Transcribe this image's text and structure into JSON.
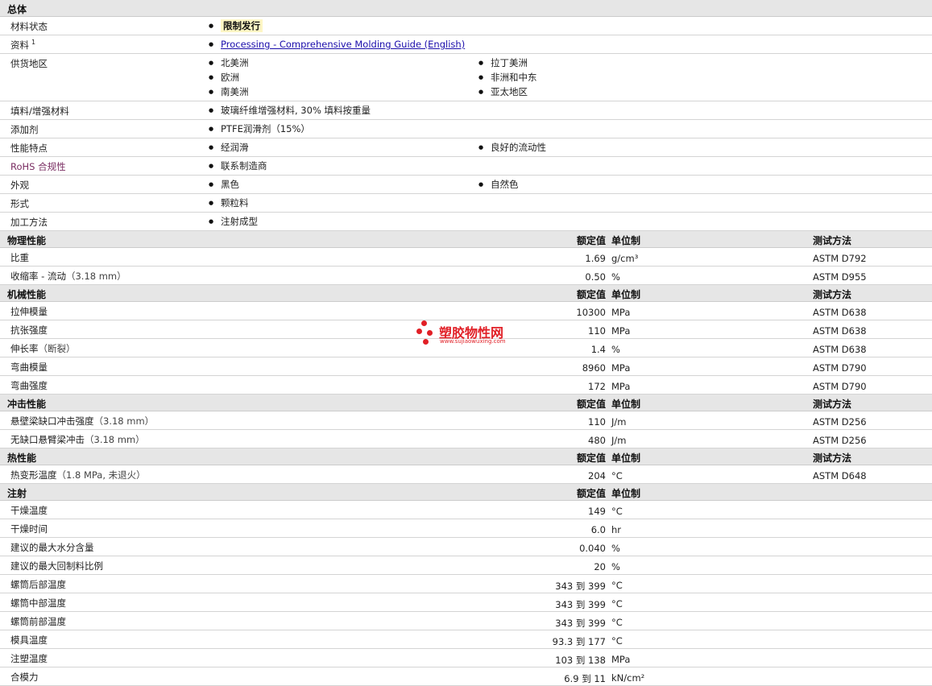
{
  "general": {
    "title": "总体",
    "rows": [
      {
        "label": "材料状态",
        "items": [
          {
            "text": "限制发行",
            "highlight": true
          }
        ]
      },
      {
        "label": "资料",
        "sup": "1",
        "items": [
          {
            "text": "Processing - Comprehensive Molding Guide (English)",
            "link": true
          }
        ]
      },
      {
        "label": "供货地区",
        "items": [
          {
            "text": "北美洲"
          },
          {
            "text": "拉丁美洲"
          },
          {
            "text": "欧洲"
          },
          {
            "text": "非洲和中东"
          },
          {
            "text": "南美洲"
          },
          {
            "text": "亚太地区"
          }
        ]
      },
      {
        "label": "填料/增强材料",
        "items": [
          {
            "text": "玻璃纤维增强材料, 30% 填料按重量"
          }
        ]
      },
      {
        "label": "添加剂",
        "items": [
          {
            "text": "PTFE润滑剂（15%）"
          }
        ]
      },
      {
        "label": "性能特点",
        "items": [
          {
            "text": "经润滑"
          },
          {
            "text": "良好的流动性"
          }
        ]
      },
      {
        "label": "RoHS 合规性",
        "rohs": true,
        "items": [
          {
            "text": "联系制造商"
          }
        ]
      },
      {
        "label": "外观",
        "items": [
          {
            "text": "黑色"
          },
          {
            "text": "自然色"
          }
        ]
      },
      {
        "label": "形式",
        "items": [
          {
            "text": "颗粒料"
          }
        ]
      },
      {
        "label": "加工方法",
        "items": [
          {
            "text": "注射成型"
          }
        ]
      }
    ]
  },
  "col_headers": {
    "value": "额定值",
    "unit": "单位制",
    "test": "测试方法"
  },
  "sections": [
    {
      "title": "物理性能",
      "show_test": true,
      "rows": [
        {
          "label": "比重",
          "cond": "",
          "value": "1.69",
          "unit": "g/cm³",
          "test": "ASTM D792"
        },
        {
          "label": "收缩率 - 流动",
          "cond": "（3.18 mm）",
          "value": "0.50",
          "unit": "%",
          "test": "ASTM D955"
        }
      ]
    },
    {
      "title": "机械性能",
      "show_test": true,
      "rows": [
        {
          "label": "拉伸模量",
          "cond": "",
          "value": "10300",
          "unit": "MPa",
          "test": "ASTM D638"
        },
        {
          "label": "抗张强度",
          "cond": "",
          "value": "110",
          "unit": "MPa",
          "test": "ASTM D638"
        },
        {
          "label": "伸长率",
          "cond": "（断裂）",
          "value": "1.4",
          "unit": "%",
          "test": "ASTM D638"
        },
        {
          "label": "弯曲模量",
          "cond": "",
          "value": "8960",
          "unit": "MPa",
          "test": "ASTM D790"
        },
        {
          "label": "弯曲强度",
          "cond": "",
          "value": "172",
          "unit": "MPa",
          "test": "ASTM D790"
        }
      ]
    },
    {
      "title": "冲击性能",
      "show_test": true,
      "rows": [
        {
          "label": "悬壁梁缺口冲击强度",
          "cond": "（3.18 mm）",
          "value": "110",
          "unit": "J/m",
          "test": "ASTM D256"
        },
        {
          "label": "无缺口悬臂梁冲击",
          "cond": "（3.18 mm）",
          "value": "480",
          "unit": "J/m",
          "test": "ASTM D256"
        }
      ]
    },
    {
      "title": "热性能",
      "show_test": true,
      "rows": [
        {
          "label": "热变形温度",
          "cond": "（1.8 MPa, 未退火）",
          "value": "204",
          "unit": "°C",
          "test": "ASTM D648"
        }
      ]
    },
    {
      "title": "注射",
      "show_test": false,
      "rows": [
        {
          "label": "干燥温度",
          "cond": "",
          "value": "149",
          "unit": "°C",
          "test": ""
        },
        {
          "label": "干燥时间",
          "cond": "",
          "value": "6.0",
          "unit": "hr",
          "test": ""
        },
        {
          "label": "建议的最大水分含量",
          "cond": "",
          "value": "0.040",
          "unit": "%",
          "test": ""
        },
        {
          "label": "建议的最大回制料比例",
          "cond": "",
          "value": "20",
          "unit": "%",
          "test": ""
        },
        {
          "label": "螺筒后部温度",
          "cond": "",
          "value": "343 到  399",
          "unit": "°C",
          "test": ""
        },
        {
          "label": "螺筒中部温度",
          "cond": "",
          "value": "343 到  399",
          "unit": "°C",
          "test": ""
        },
        {
          "label": "螺筒前部温度",
          "cond": "",
          "value": "343 到  399",
          "unit": "°C",
          "test": ""
        },
        {
          "label": "模具温度",
          "cond": "",
          "value": "93.3 到  177",
          "unit": "°C",
          "test": ""
        },
        {
          "label": "注塑温度",
          "cond": "",
          "value": "103 到  138",
          "unit": "MPa",
          "test": ""
        },
        {
          "label": "合模力",
          "cond": "",
          "value": "6.9 到  11",
          "unit": "kN/cm²",
          "test": ""
        }
      ]
    }
  ],
  "watermark": {
    "title": "塑胶物性网",
    "subtitle": "www.sujiaowuxing.com",
    "color": "#e11f26"
  }
}
